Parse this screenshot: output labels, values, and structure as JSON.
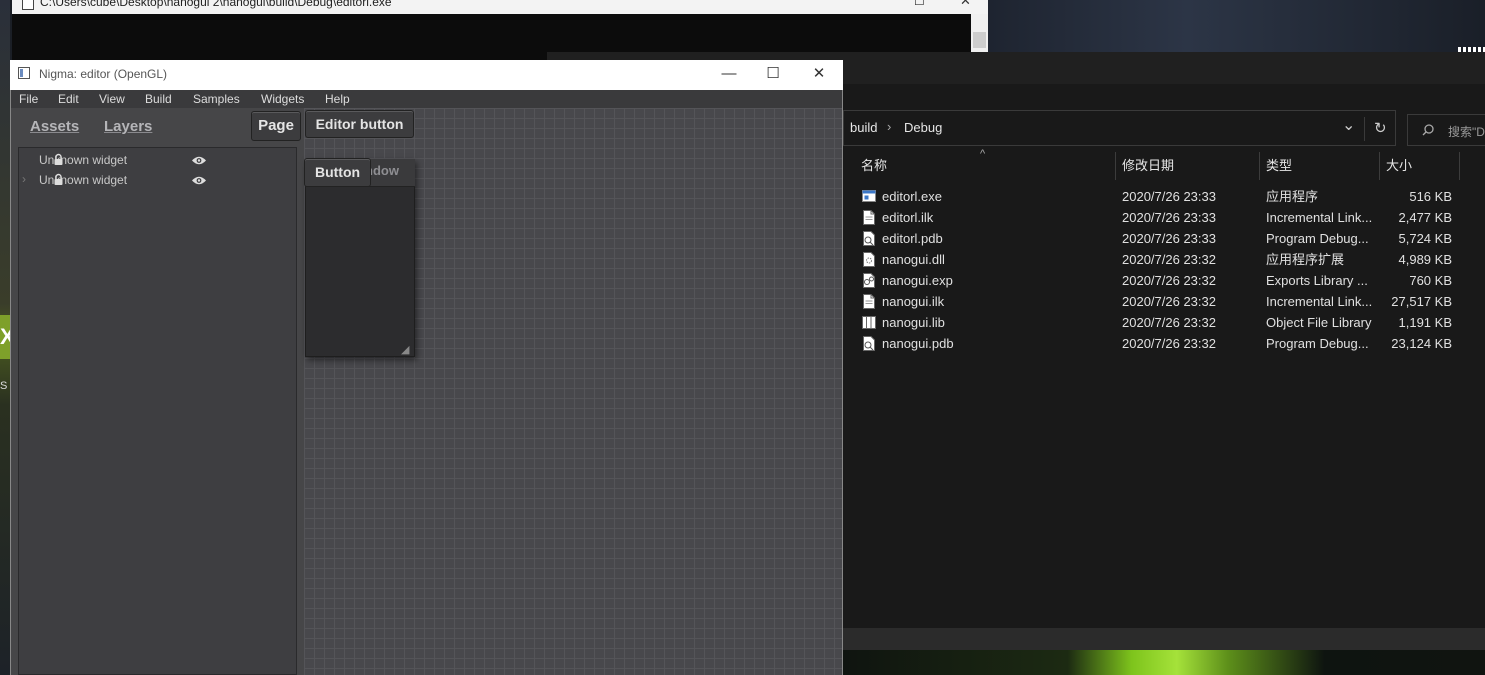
{
  "console": {
    "title": "C:\\Users\\cube\\Desktop\\nanogui 2\\nanogui\\build\\Debug\\editorl.exe",
    "max_glyph": "☐",
    "close_glyph": "✕"
  },
  "desktop": {
    "left_letter": "X",
    "left_small": "S"
  },
  "editor_window": {
    "title": "Nigma: editor (OpenGL)",
    "minimize_glyph": "—",
    "maximize_glyph": "☐",
    "close_glyph": "✕",
    "menu": [
      "File",
      "Edit",
      "View",
      "Build",
      "Samples",
      "Widgets",
      "Help"
    ],
    "tabs": {
      "assets": "Assets",
      "layers": "Layers"
    },
    "page_button": "Page",
    "editor_button": "Editor button",
    "layers": [
      {
        "name": "Unknown widget",
        "expander": ""
      },
      {
        "name": "Unknown widget",
        "expander": "›"
      }
    ],
    "lock_glyph": "🔒",
    "eye_glyph": "👁",
    "subwindow": {
      "title": "ndow",
      "button": "Button",
      "grip": "◢"
    }
  },
  "explorer": {
    "breadcrumb": [
      "build",
      "Debug"
    ],
    "breadcrumb_sep": "›",
    "dropdown_glyph": "⌄",
    "refresh_glyph": "↻",
    "search_placeholder": "搜索\"D",
    "search_icon": "search-icon",
    "sort_glyph": "^",
    "columns": {
      "name": "名称",
      "modified": "修改日期",
      "type": "类型",
      "size": "大小"
    },
    "files": [
      {
        "name": "editorl.exe",
        "modified": "2020/7/26 23:33",
        "type": "应用程序",
        "size": "516 KB",
        "icon": "exe-icon"
      },
      {
        "name": "editorl.ilk",
        "modified": "2020/7/26 23:33",
        "type": "Incremental Link...",
        "size": "2,477 KB",
        "icon": "doc-icon"
      },
      {
        "name": "editorl.pdb",
        "modified": "2020/7/26 23:33",
        "type": "Program Debug...",
        "size": "5,724 KB",
        "icon": "pdb-icon"
      },
      {
        "name": "nanogui.dll",
        "modified": "2020/7/26 23:32",
        "type": "应用程序扩展",
        "size": "4,989 KB",
        "icon": "dll-icon"
      },
      {
        "name": "nanogui.exp",
        "modified": "2020/7/26 23:32",
        "type": "Exports Library ...",
        "size": "760 KB",
        "icon": "exp-icon"
      },
      {
        "name": "nanogui.ilk",
        "modified": "2020/7/26 23:32",
        "type": "Incremental Link...",
        "size": "27,517 KB",
        "icon": "doc-icon"
      },
      {
        "name": "nanogui.lib",
        "modified": "2020/7/26 23:32",
        "type": "Object File Library",
        "size": "1,191 KB",
        "icon": "lib-icon"
      },
      {
        "name": "nanogui.pdb",
        "modified": "2020/7/26 23:32",
        "type": "Program Debug...",
        "size": "23,124 KB",
        "icon": "pdb-icon"
      }
    ]
  }
}
